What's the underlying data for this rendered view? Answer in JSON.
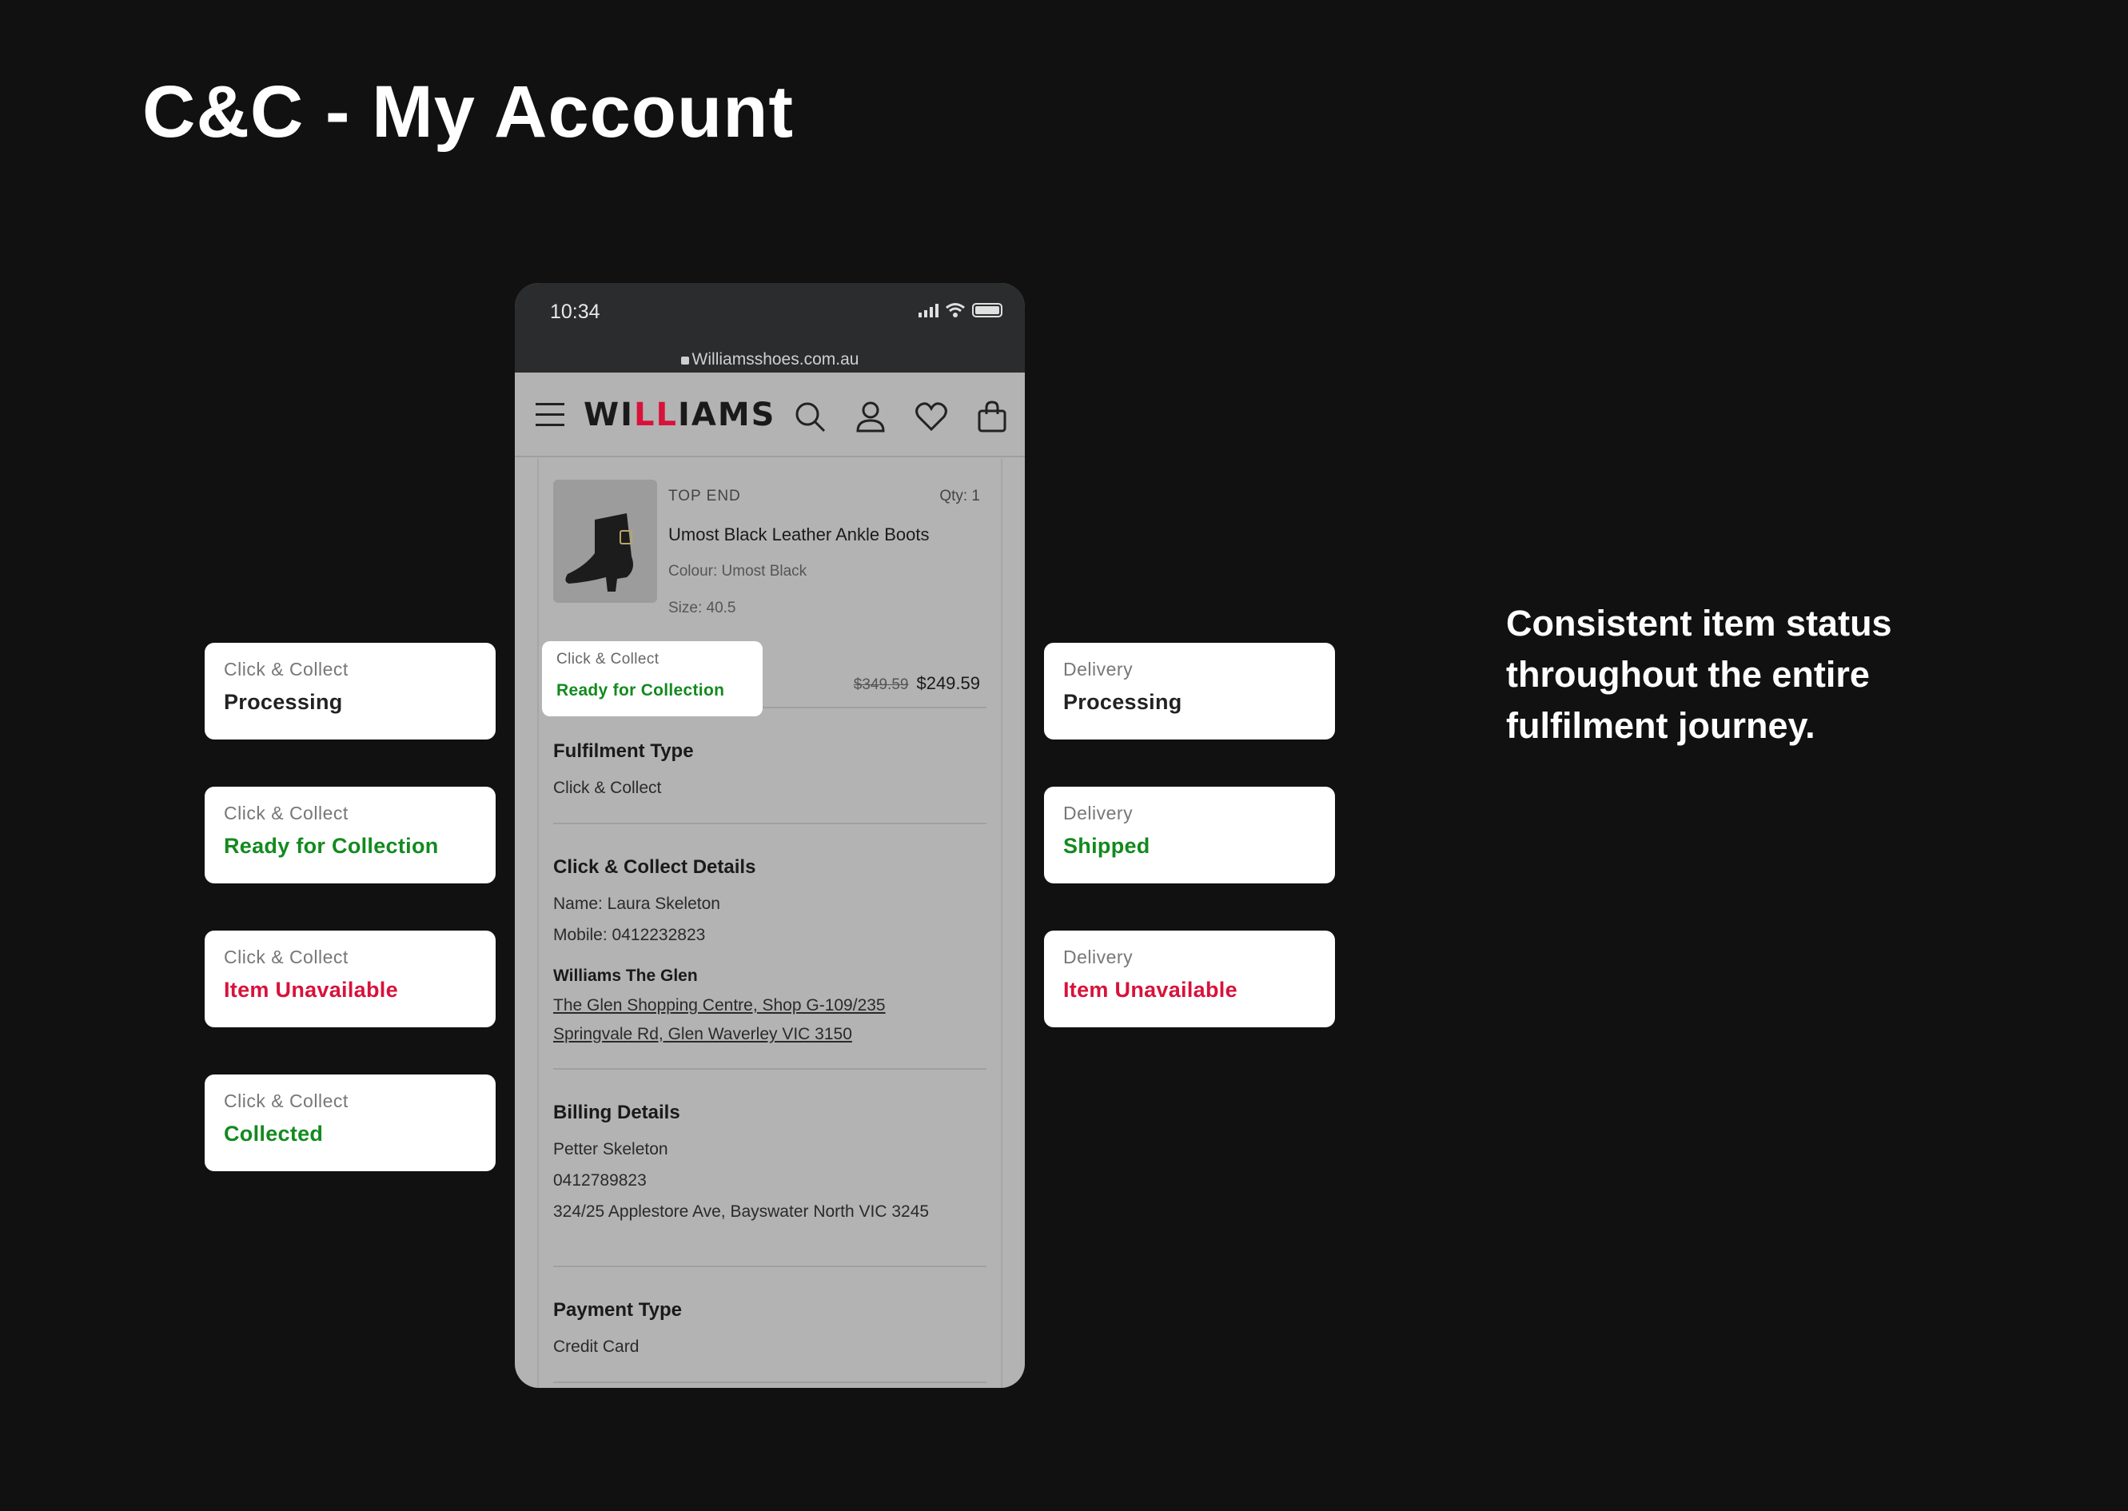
{
  "page_title": "C&C - My Account",
  "tagline": "Consistent item status throughout the entire fulfilment journey.",
  "status_cards_left": [
    {
      "type": "Click & Collect",
      "status": "Processing",
      "color": "#222222"
    },
    {
      "type": "Click & Collect",
      "status": "Ready for Collection",
      "color": "#138a1f"
    },
    {
      "type": "Click & Collect",
      "status": "Item Unavailable",
      "color": "#d8123a"
    },
    {
      "type": "Click & Collect",
      "status": "Collected",
      "color": "#138a1f"
    }
  ],
  "status_cards_right": [
    {
      "type": "Delivery",
      "status": "Processing",
      "color": "#222222"
    },
    {
      "type": "Delivery",
      "status": "Shipped",
      "color": "#138a1f"
    },
    {
      "type": "Delivery",
      "status": "Item Unavailable",
      "color": "#d8123a"
    }
  ],
  "phone": {
    "time": "10:34",
    "url": "Williamsshoes.com.au",
    "logo_left": "WI",
    "logo_mid": "LL",
    "logo_right": "IAMS"
  },
  "product": {
    "brand": "TOP END",
    "qty": "Qty: 1",
    "name": "Umost Black Leather Ankle Boots",
    "colour": "Colour: Umost Black",
    "size": "Size: 40.5",
    "old_price": "$349.59",
    "price": "$249.59",
    "badge_type": "Click & Collect",
    "badge_status": "Ready for Collection"
  },
  "fulfilment": {
    "heading": "Fulfilment Type",
    "value": "Click & Collect"
  },
  "cc_details": {
    "heading": "Click & Collect Details",
    "name": "Name: Laura Skeleton",
    "mobile": "Mobile: 0412232823",
    "store": "Williams The Glen",
    "addr1": "The Glen Shopping Centre, Shop G-109/235",
    "addr2": "Springvale Rd, Glen Waverley VIC 3150"
  },
  "billing": {
    "heading": "Billing Details",
    "name": "Petter Skeleton",
    "phone": "0412789823",
    "address": "324/25 Applestore Ave, Bayswater North VIC 3245"
  },
  "payment": {
    "heading": "Payment Type",
    "value": "Credit Card"
  }
}
